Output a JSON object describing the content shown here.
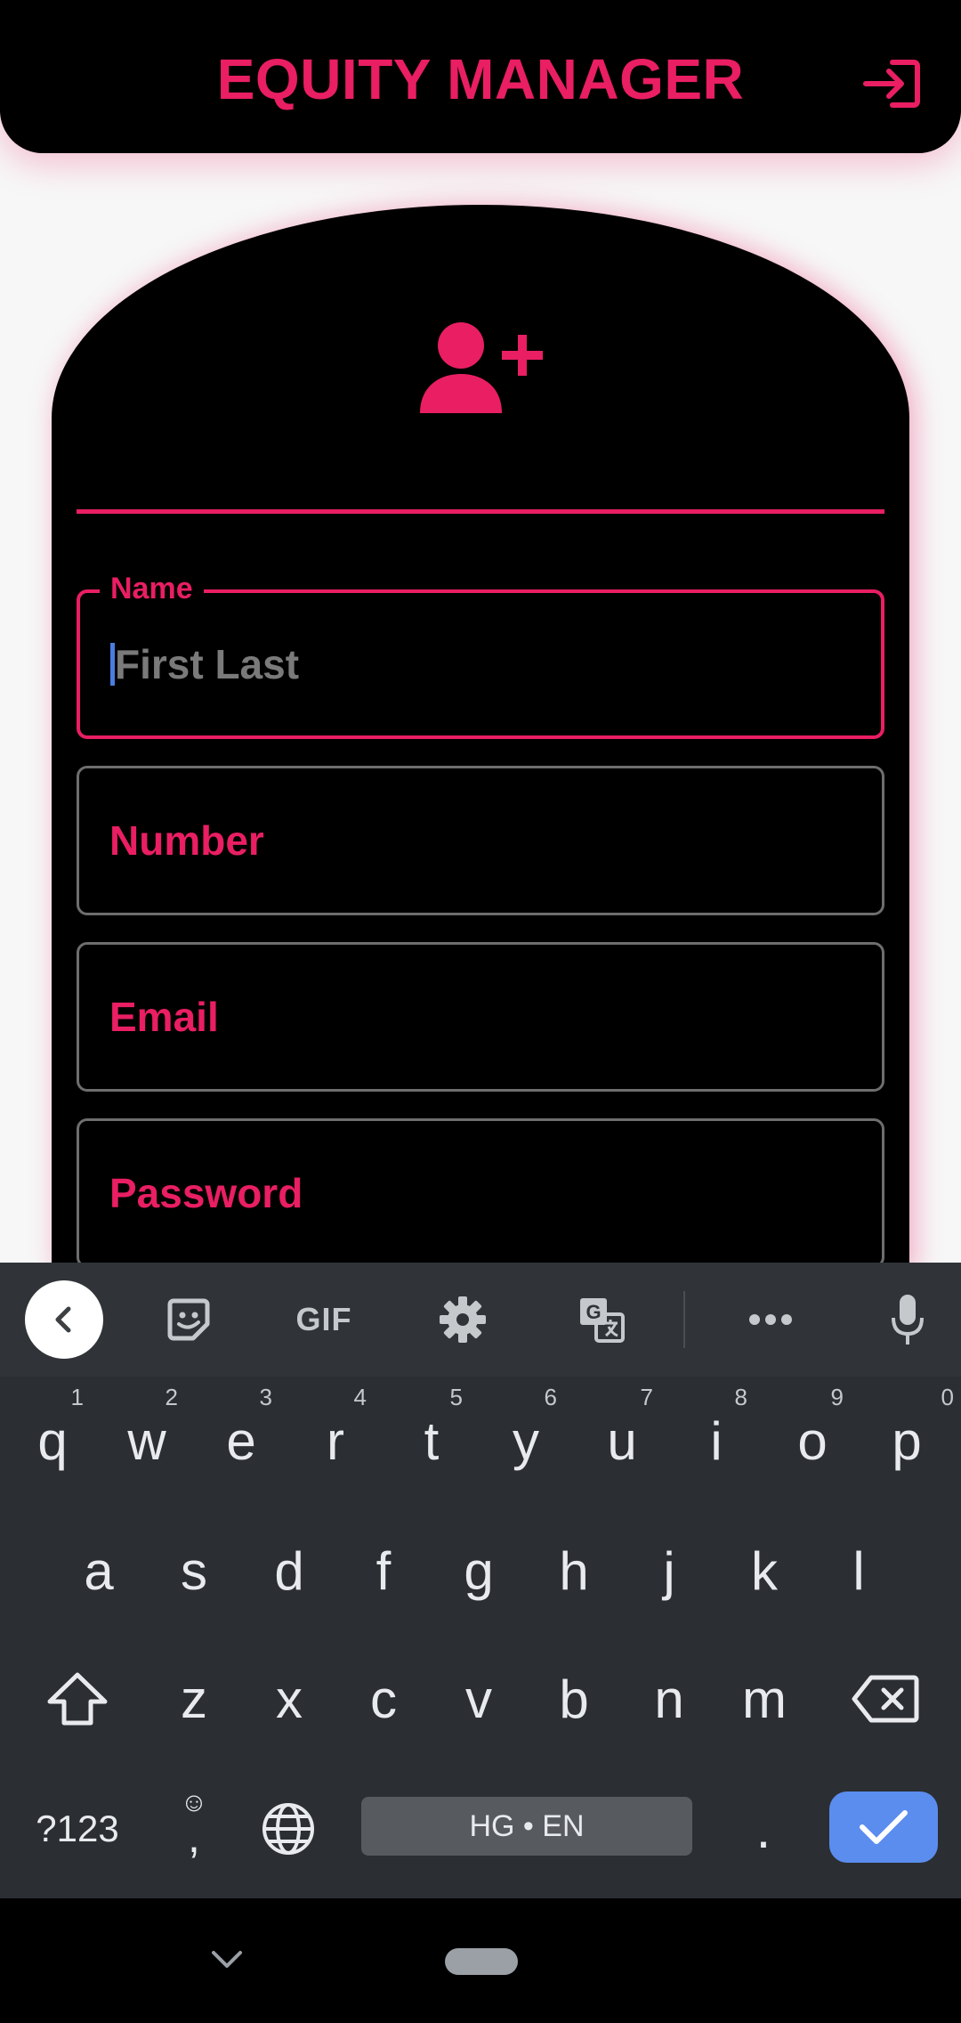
{
  "app": {
    "title": "EQUITY MANAGER"
  },
  "icons": {
    "logout": "login-arrow-icon",
    "add_user": "add-user-icon"
  },
  "colors": {
    "accent": "#e91e63",
    "background": "#000000",
    "page": "#f7f7f7"
  },
  "form": {
    "name": {
      "label": "Name",
      "placeholder": "First Last"
    },
    "number": {
      "label": "Number"
    },
    "email": {
      "label": "Email"
    },
    "password": {
      "label": "Password"
    }
  },
  "keyboard": {
    "toolbar": {
      "gif": "GIF"
    },
    "row1": [
      "q",
      "w",
      "e",
      "r",
      "t",
      "y",
      "u",
      "i",
      "o",
      "p"
    ],
    "row1_hints": [
      "1",
      "2",
      "3",
      "4",
      "5",
      "6",
      "7",
      "8",
      "9",
      "0"
    ],
    "row2": [
      "a",
      "s",
      "d",
      "f",
      "g",
      "h",
      "j",
      "k",
      "l"
    ],
    "row3": [
      "z",
      "x",
      "c",
      "v",
      "b",
      "n",
      "m"
    ],
    "symbols_label": "?123",
    "comma": ",",
    "period": ".",
    "space_label": "HG • EN"
  }
}
